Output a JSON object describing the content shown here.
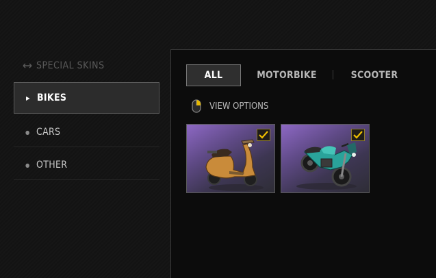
{
  "sidebar": {
    "section_title": "SPECIAL SKINS",
    "items": [
      {
        "label": "BIKES",
        "active": true
      },
      {
        "label": "CARS",
        "active": false
      },
      {
        "label": "OTHER",
        "active": false
      }
    ]
  },
  "tabs": [
    {
      "label": "ALL",
      "active": true
    },
    {
      "label": "MOTORBIKE",
      "active": false
    },
    {
      "label": "SCOOTER",
      "active": false
    }
  ],
  "view_options_label": "VIEW OPTIONS",
  "skins": [
    {
      "name": "scooter-skin",
      "icon": "scooter-icon",
      "selected": true
    },
    {
      "name": "motorbike-skin",
      "icon": "motorbike-icon",
      "selected": true
    }
  ],
  "colors": {
    "accent_check": "#f0c000",
    "card_gradient_top": "#8d68c4"
  }
}
